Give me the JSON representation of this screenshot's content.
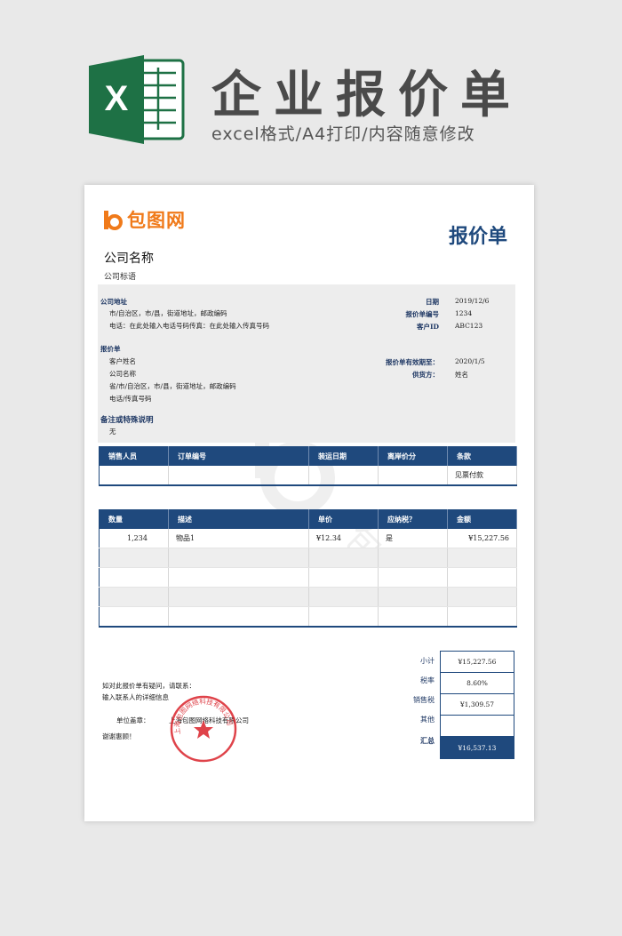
{
  "banner": {
    "title": "企业报价单",
    "subtitle": "excel格式/A4打印/内容随意修改",
    "excel_letter": "X"
  },
  "colors": {
    "navy": "#1f497d",
    "orange": "#f07a1a",
    "excel_green": "#1e7145",
    "stamp_red": "#d9222a"
  },
  "brand": {
    "name": "包图网"
  },
  "doc": {
    "title": "报价单",
    "company_name": "公司名称",
    "company_slogan": "公司标语"
  },
  "seller": {
    "heading": "公司地址",
    "address": "市/自治区，市/县，街道地址，邮政编码",
    "phone_fax": "电话：在此处输入电话号码传真：在此处输入传真号码"
  },
  "meta": [
    {
      "label": "日期",
      "value": "2019/12/6"
    },
    {
      "label": "报价单编号",
      "value": "1234"
    },
    {
      "label": "客户ID",
      "value": "ABC123"
    }
  ],
  "quote_to": {
    "heading": "报价单",
    "lines": [
      "客户姓名",
      "公司名称",
      "省/市/自治区，市/县，街道地址，邮政编码",
      "电话/传真号码"
    ]
  },
  "validity": [
    {
      "label": "报价单有效期至：",
      "value": "2020/1/5"
    },
    {
      "label": "供货方：",
      "value": "姓名"
    }
  ],
  "remarks": {
    "heading": "备注或特殊说明",
    "text": "无"
  },
  "sales_table": {
    "headers": [
      "销售人员",
      "订单编号",
      "装运日期",
      "离岸价分",
      "条款"
    ],
    "rows": [
      [
        "",
        "",
        "",
        "",
        "见票付款"
      ]
    ]
  },
  "items_table": {
    "headers": [
      "数量",
      "描述",
      "单价",
      "应纳税？",
      "金额"
    ],
    "rows": [
      [
        "1,234",
        "物品1",
        "¥12.34",
        "是",
        "¥15,227.56"
      ],
      [
        "",
        "",
        "",
        "",
        ""
      ],
      [
        "",
        "",
        "",
        "",
        ""
      ],
      [
        "",
        "",
        "",
        "",
        ""
      ],
      [
        "",
        "",
        "",
        "",
        ""
      ]
    ]
  },
  "totals": [
    {
      "label": "小计",
      "value": "¥15,227.56"
    },
    {
      "label": "税率",
      "value": "8.60%"
    },
    {
      "label": "销售税",
      "value": "¥1,309.57"
    },
    {
      "label": "其他",
      "value": ""
    },
    {
      "label": "汇总",
      "value": "¥16,537.13"
    }
  ],
  "footer": {
    "question": "如对此报价单有疑问，请联系：",
    "contact": "输入联系人的详细信息",
    "seal_label": "单位盖章：",
    "seal_company": "上海包图网络科技有限公司",
    "thanks": "谢谢惠顾！"
  },
  "stamp": {
    "text": "上海包图网络科技有限公司"
  }
}
